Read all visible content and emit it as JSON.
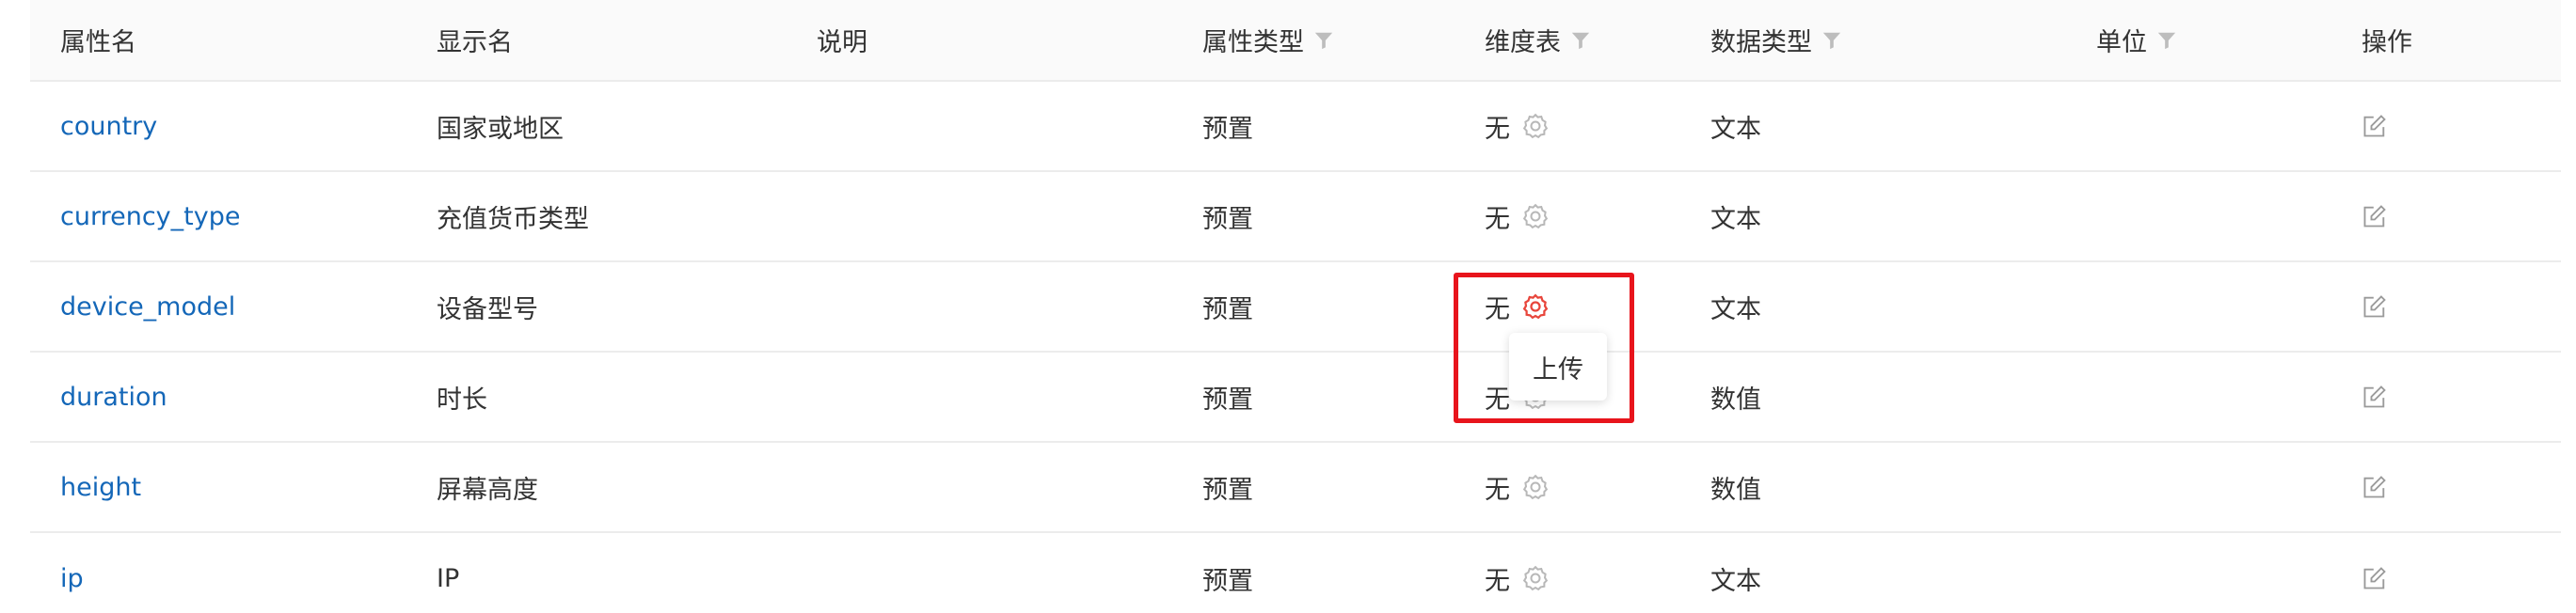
{
  "columns": {
    "name": "属性名",
    "display": "显示名",
    "desc": "说明",
    "attr_type": "属性类型",
    "dim_table": "维度表",
    "data_type": "数据类型",
    "unit": "单位",
    "action": "操作"
  },
  "rows": [
    {
      "name": "country",
      "display": "国家或地区",
      "desc": "",
      "attr_type": "预置",
      "dim_table": "无",
      "data_type": "文本",
      "unit": ""
    },
    {
      "name": "currency_type",
      "display": "充值货币类型",
      "desc": "",
      "attr_type": "预置",
      "dim_table": "无",
      "data_type": "文本",
      "unit": ""
    },
    {
      "name": "device_model",
      "display": "设备型号",
      "desc": "",
      "attr_type": "预置",
      "dim_table": "无",
      "data_type": "文本",
      "unit": ""
    },
    {
      "name": "duration",
      "display": "时长",
      "desc": "",
      "attr_type": "预置",
      "dim_table": "无",
      "data_type": "数值",
      "unit": ""
    },
    {
      "name": "height",
      "display": "屏幕高度",
      "desc": "",
      "attr_type": "预置",
      "dim_table": "无",
      "data_type": "数值",
      "unit": ""
    },
    {
      "name": "ip",
      "display": "IP",
      "desc": "",
      "attr_type": "预置",
      "dim_table": "无",
      "data_type": "文本",
      "unit": ""
    }
  ],
  "tooltip": {
    "label": "上传"
  },
  "colors": {
    "link": "#1467b8",
    "gear_default": "#b8b8b8",
    "gear_active": "#e8463c",
    "highlight": "#e8141c"
  },
  "icons": {
    "filter": "filter-icon",
    "gear": "gear-icon",
    "edit": "edit-icon"
  }
}
